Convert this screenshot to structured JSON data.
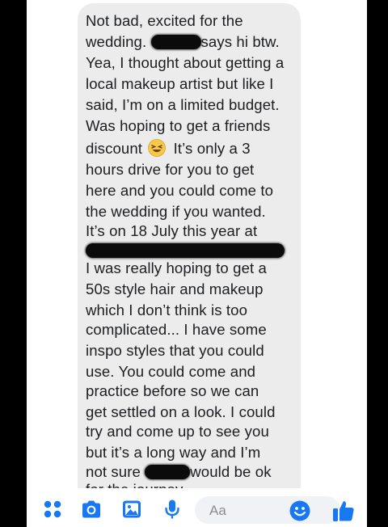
{
  "message": {
    "lines": [
      "Not bad, excited for the",
      "wedding.",
      "says hi btw.",
      "Yea, I thought about getting a",
      "local makeup artist but like I",
      "said, I’m on a limited budget.",
      "Was hoping to get a friends",
      "discount",
      "It’s only a 3",
      "hours drive for you to get",
      "here and you could come to",
      "the wedding if you wanted.",
      "It’s on 18 July this year at",
      "I was really hoping to get a",
      "50s style hair and makeup",
      "which I don’t think is too",
      "complicated... I have some",
      "inspo styles that you could",
      "use. You could come and",
      "practice before so we can",
      "get settled on a look. I could",
      "try and come up to see you",
      "but it’s a long way and I’m",
      "not sure",
      "would be ok",
      "for the journey"
    ]
  },
  "composer": {
    "placeholder": "Aa",
    "tools": [
      "apps-icon",
      "camera-icon",
      "gallery-icon",
      "microphone-icon"
    ]
  },
  "colors": {
    "accent": "#1877f2",
    "bubble": "#ececec",
    "text": "#1c1e21"
  }
}
